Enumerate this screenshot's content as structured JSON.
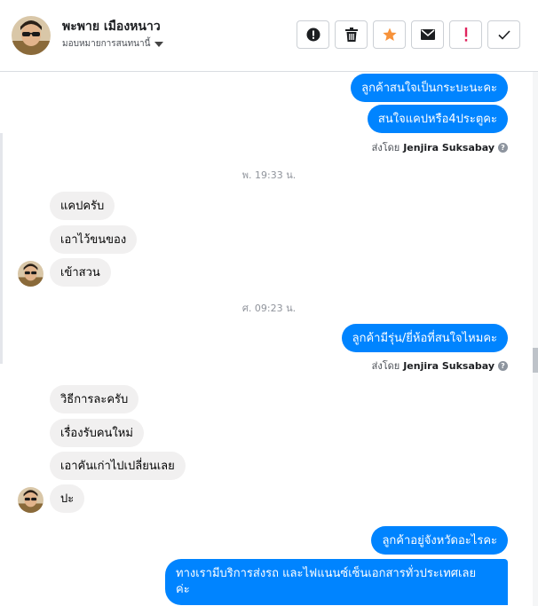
{
  "header": {
    "contact_name": "พะพาย เมืองหนาว",
    "assign_label": "มอบหมายการสนทนานี้"
  },
  "toolbar": {
    "buttons": [
      {
        "name": "alert-circle-icon"
      },
      {
        "name": "trash-icon"
      },
      {
        "name": "star-icon",
        "color": "#f7923a"
      },
      {
        "name": "envelope-icon"
      },
      {
        "name": "exclamation-icon",
        "color": "#e0245e"
      },
      {
        "name": "check-icon"
      }
    ]
  },
  "messages": {
    "m1": "ลูกค้าสนใจเป็นกระบะนะคะ",
    "m2": "สนใจแคปหรือ4ประตูคะ",
    "sent1_prefix": "ส่งโดย",
    "sent1_name": "Jenjira Suksabay",
    "ts1": "พ. 19:33 น.",
    "m3": "แคปครับ",
    "m4": "เอาไว้ขนของ",
    "m5": "เข้าสวน",
    "ts2": "ศ. 09:23 น.",
    "m6": "ลูกค้ามีรุ่น/ยี่ห้อที่สนใจไหมคะ",
    "sent2_prefix": "ส่งโดย",
    "sent2_name": "Jenjira Suksabay",
    "m7": "วิธีการละครับ",
    "m8": "เรื่องรับคนใหม่",
    "m9": "เอาคันเก่าไปเปลี่ยนเลย",
    "m10": "ปะ",
    "m11": "ลูกค้าอยู่จังหวัดอะไรคะ",
    "m12_line1": "ทางเรามีบริการส่งรถ และไฟแนนซ์เซ็นเอกสารทั่วประเทศเลย",
    "m12_line2": "ค่ะ"
  },
  "colors": {
    "outgoing_bubble": "#0084ff",
    "incoming_bubble": "#f1f0f0"
  }
}
